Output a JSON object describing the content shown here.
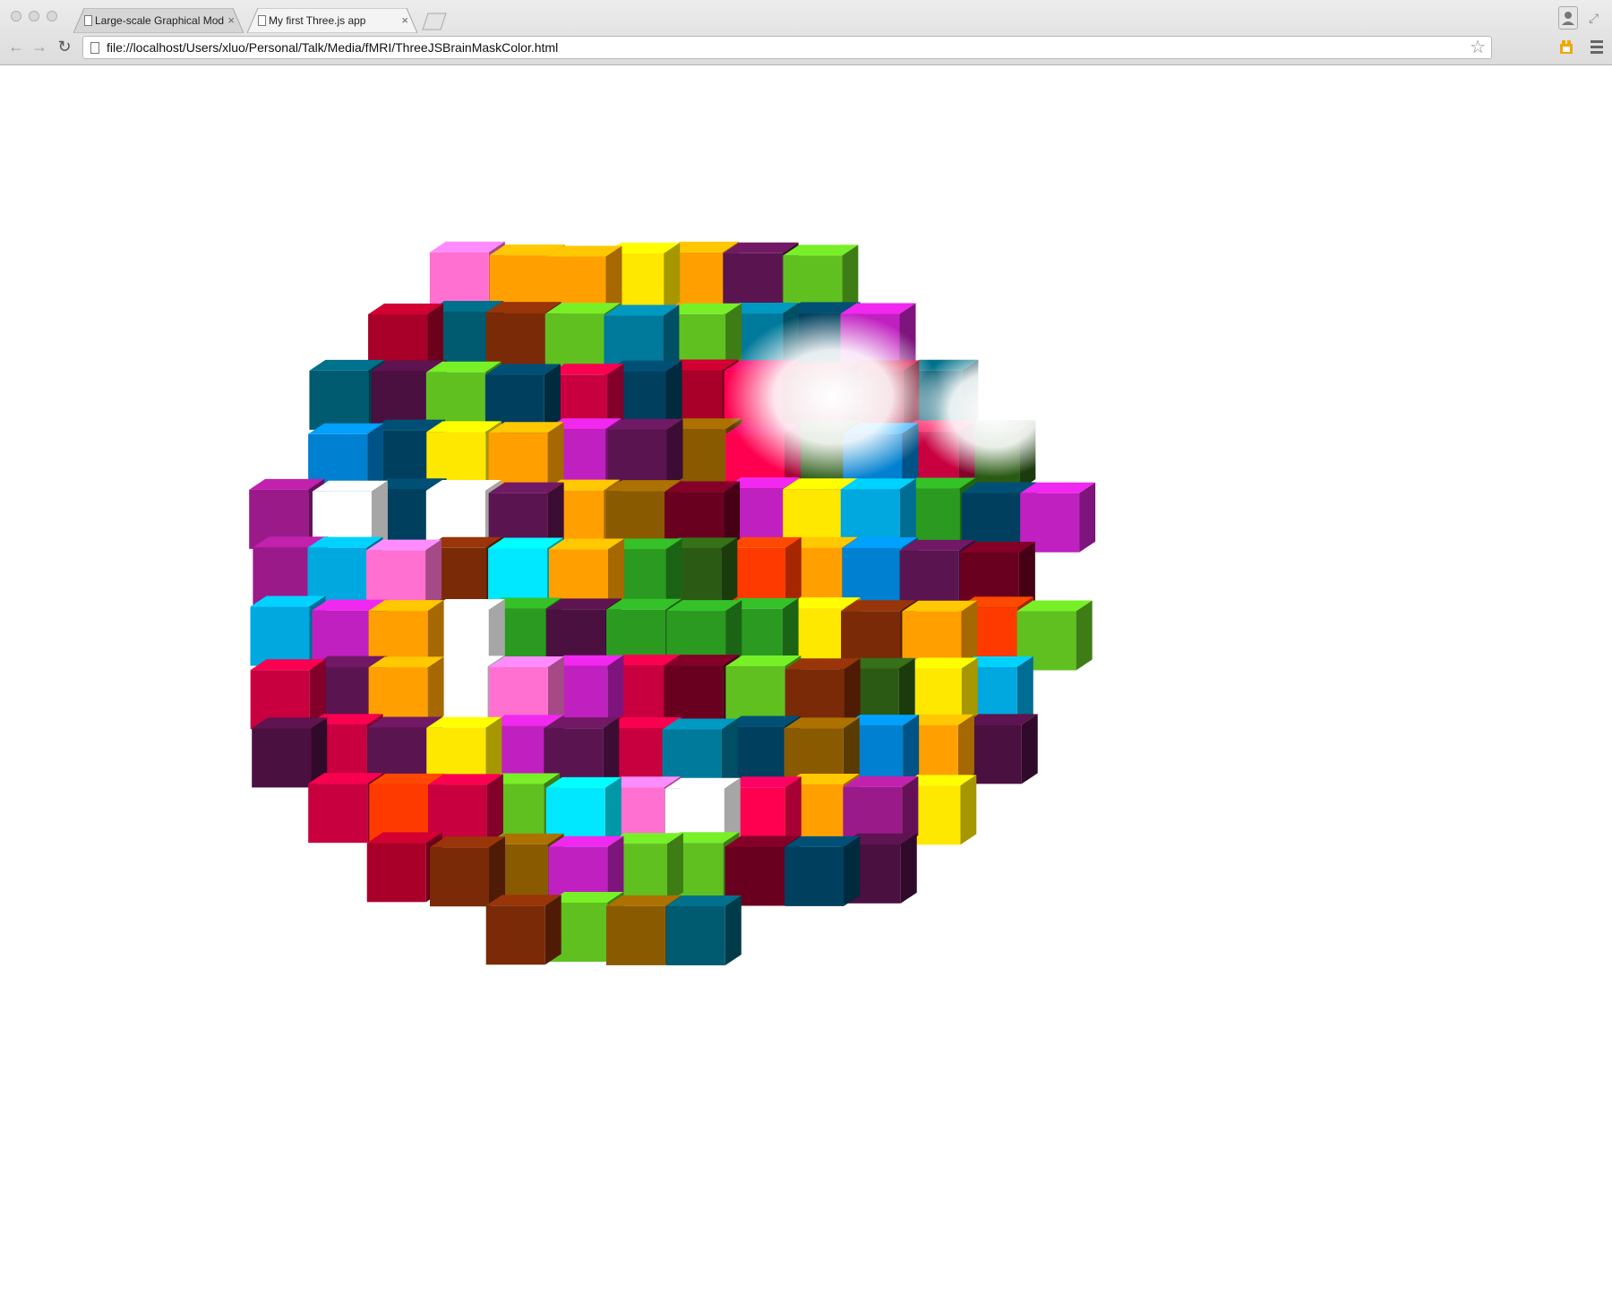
{
  "tabs": [
    {
      "label": "Large-scale Graphical Mod",
      "close": "×"
    },
    {
      "label": "My first Three.js app",
      "close": "×"
    }
  ],
  "toolbar": {
    "url": "file://localhost/Users/xluo/Personal/Talk/Media/fMRI/ThreeJSBrainMaskColor.html",
    "back_icon": "arrow-left-icon",
    "forward_icon": "arrow-right-icon",
    "reload_icon": "reload-icon",
    "star_icon": "star-icon",
    "menu_icon": "hamburger-menu-icon"
  },
  "scene": {
    "palette": [
      "#6a0020",
      "#4a1040",
      "#00405e",
      "#005a70",
      "#2a5a14",
      "#7a2a06",
      "#8a5a00",
      "#5a1450",
      "#007a9a",
      "#a80028",
      "#c80040",
      "#ff0050",
      "#ff3a00",
      "#ffa000",
      "#ffe800",
      "#60c020",
      "#2a9a20",
      "#00a8e0",
      "#0080d0",
      "#00e8ff",
      "#c020c0",
      "#9a1a8a",
      "#ff70d0",
      "#ffffff"
    ]
  }
}
